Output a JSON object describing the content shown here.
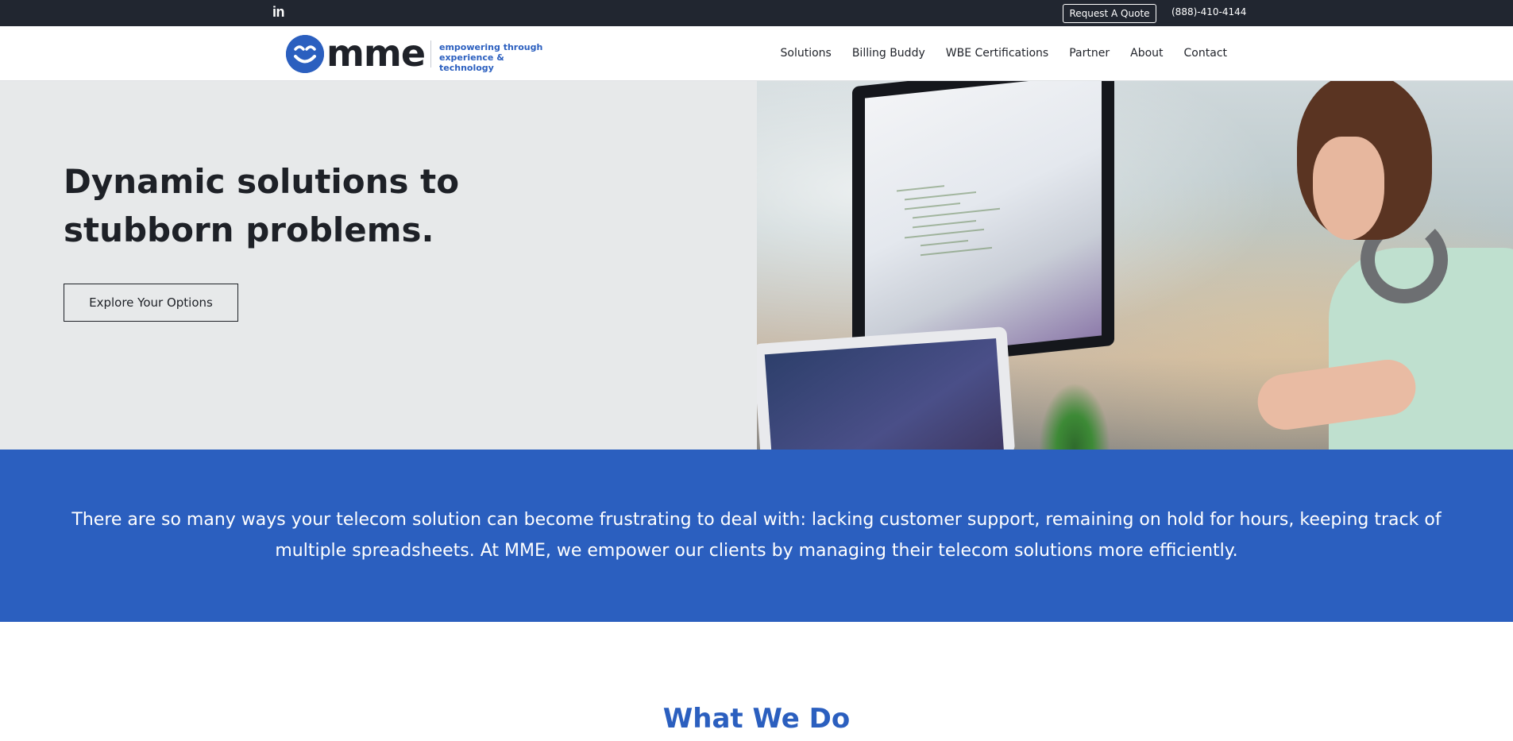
{
  "topbar": {
    "linkedin_label": "in",
    "quote_button": "Request A Quote",
    "phone": "(888)-410-4144"
  },
  "header": {
    "logo_text": "mme",
    "tagline_line1": "empowering through",
    "tagline_line2": "experience & technology",
    "nav": [
      "Solutions",
      "Billing Buddy",
      "WBE Certifications",
      "Partner",
      "About",
      "Contact"
    ]
  },
  "hero": {
    "title": "Dynamic solutions to stubborn problems.",
    "button_label": "Explore Your Options",
    "image_icon": "woman-at-computer-photo"
  },
  "intro": {
    "text": "There are so many ways your telecom solution can become frustrating to deal with: lacking customer support, remaining on hold for hours, keeping track of multiple spreadsheets. At MME, we empower our clients by managing their telecom solutions more efficiently."
  },
  "what_we_do": {
    "title": "What We Do"
  },
  "colors": {
    "topbar_bg": "#212630",
    "brand_blue": "#2b5fbf",
    "hero_left_bg": "#e7e9ea",
    "text_dark": "#1e2127"
  }
}
